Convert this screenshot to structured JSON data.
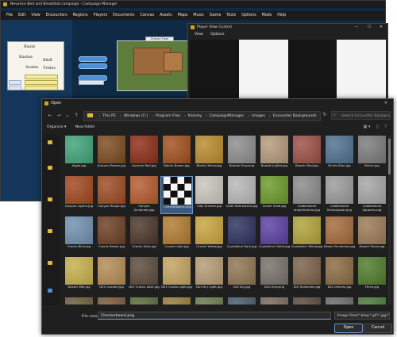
{
  "campaign_window": {
    "title": "Neverice Bed and Breakfast.campaign - Campaign Manager",
    "menu": [
      "File",
      "Edit",
      "View",
      "Encounters",
      "Regions",
      "Players",
      "Documents",
      "Canvas",
      "Assets",
      "Maps",
      "Music",
      "Game",
      "Tools",
      "Options",
      "Mods",
      "Help"
    ],
    "map_labels": {
      "a": "Basin",
      "b": "Kaslea",
      "c": "B&B",
      "d": "Avales",
      "e": "Trelos"
    },
    "map_tag": "Ground Floor"
  },
  "player_window": {
    "title": "Player View Control",
    "menu": [
      "View",
      "Options"
    ]
  },
  "open_dialog": {
    "title": "Open",
    "path": [
      "This PC",
      "Windows (C:)",
      "Program Files",
      "Kamoly",
      "CampaignManager",
      "Images",
      "Encounter Backgrounds"
    ],
    "search_placeholder": "Search Encounter Backgroun...",
    "organize_label": "Organize ▾",
    "new_folder_label": "New folder",
    "file_name_label": "File name:",
    "file_name_value": "Checkerboard.png",
    "file_type_value": "Image Files(*.bmp;*.gif;*.jpg;*.j",
    "open_label": "Open",
    "cancel_label": "Cancel",
    "files": [
      {
        "name": "Algae.jpg",
        "color": "#3fa377"
      },
      {
        "name": "Autumn Brown.jpg",
        "color": "#7a4a1f"
      },
      {
        "name": "Autumn Red.jpg",
        "color": "#8c2d16"
      },
      {
        "name": "Blocks Brown.jpg",
        "color": "#a14f1d"
      },
      {
        "name": "Blocks Yellow.jpg",
        "color": "#b98b2c"
      },
      {
        "name": "Boards Gray.png",
        "color": "#8c8c8c"
      },
      {
        "name": "Boards Jupiter.jpg",
        "color": "#b39a7c"
      },
      {
        "name": "Boards Red.jpg",
        "color": "#9b4f45"
      },
      {
        "name": "Bricks Blue.jpg",
        "color": "#4f6f8f"
      },
      {
        "name": "Bricks.jpg",
        "color": "#7a7a7a"
      },
      {
        "name": "Canyon Layers.jpg",
        "color": "#a0461d"
      },
      {
        "name": "Canyon Rough.jpg",
        "color": "#9c4a22"
      },
      {
        "name": "Canyon Scratches.jpg",
        "color": "#b45a2c"
      },
      {
        "name": "Checkerboard.png",
        "color": "checker"
      },
      {
        "name": "Clay Uneven.jpg",
        "color": "#c8c6bd"
      },
      {
        "name": "Cloth Interwoven.jpg",
        "color": "#b7b7b7"
      },
      {
        "name": "Clover Solid.jpg",
        "color": "#6a9a2a"
      },
      {
        "name": "Cobblestone Imperfections.jpg",
        "color": "#8a8a8a"
      },
      {
        "name": "Cobblestone Rectangular.png",
        "color": "#9a9a9a"
      },
      {
        "name": "Cobblestone Squares.png",
        "color": "#a5a5a5"
      },
      {
        "name": "Cracks Blue.jpg",
        "color": "#6f8faf"
      },
      {
        "name": "Cracks Brown.jpg",
        "color": "#6b3e22"
      },
      {
        "name": "Cracks Dark.jpg",
        "color": "#4a3528"
      },
      {
        "name": "Cracks Light.jpg",
        "color": "#b17b2f"
      },
      {
        "name": "Cracks Yellow.jpg",
        "color": "#c7a43c"
      },
      {
        "name": "Crystalline Dark.jpg",
        "color": "#2e2f5e"
      },
      {
        "name": "Crystalline Violet.jpg",
        "color": "#5a3fa0"
      },
      {
        "name": "Crystalline Yellow.jpg",
        "color": "#b0a23a"
      },
      {
        "name": "Desert Scratches.jpg",
        "color": "#a36a3a"
      },
      {
        "name": "Desert Stone.jpg",
        "color": "#9a7a55"
      },
      {
        "name": "Desert Wet.jpg",
        "color": "#c7b04c"
      },
      {
        "name": "Dirt Cracked.jpg",
        "color": "#b38b54"
      },
      {
        "name": "Dirt Cracks Dark.jpg",
        "color": "#5a4a3a"
      },
      {
        "name": "Dirt Cracks Light.jpg",
        "color": "#c2a35f"
      },
      {
        "name": "Dirt Dry Light.jpg",
        "color": "#b59b74"
      },
      {
        "name": "Dirt Dry.jpg",
        "color": "#8f7553"
      },
      {
        "name": "Dirt Grey.png",
        "color": "#777068"
      },
      {
        "name": "Dirt Splotches.jpg",
        "color": "#7a6048"
      },
      {
        "name": "Dirt Uneven.jpg",
        "color": "#8a6a42"
      },
      {
        "name": "Ferns.jpg",
        "color": "#4f7a2a"
      },
      {
        "name": "",
        "color": "#6a5d3a"
      },
      {
        "name": "",
        "color": "#7a5a3a"
      },
      {
        "name": "",
        "color": "#5a6a3a"
      },
      {
        "name": "",
        "color": "#9a7a3a"
      },
      {
        "name": "",
        "color": "#6a7a4a"
      },
      {
        "name": "",
        "color": "#4a5a6a"
      },
      {
        "name": "",
        "color": "#7a6a5a"
      },
      {
        "name": "",
        "color": "#5a4a3a"
      },
      {
        "name": "",
        "color": "#6a6a6a"
      },
      {
        "name": "",
        "color": "#4a7a3a"
      }
    ]
  }
}
